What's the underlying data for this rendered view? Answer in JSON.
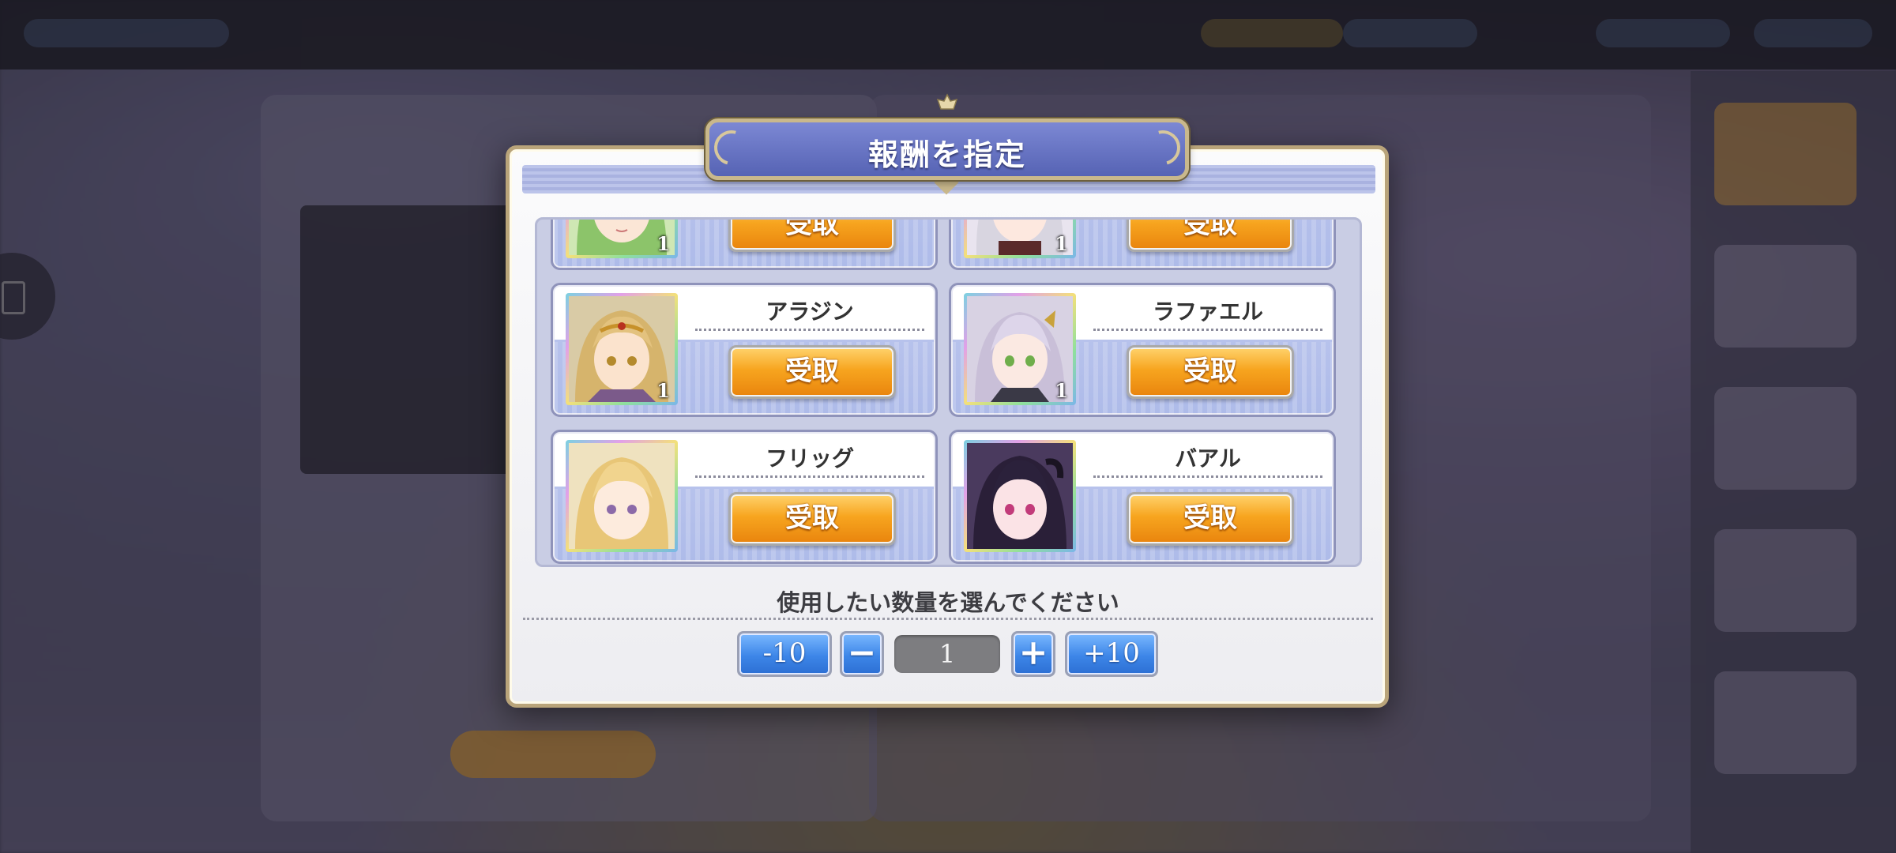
{
  "dialog": {
    "title": "報酬を指定",
    "quantity_prompt": "使用したい数量を選んでください"
  },
  "rewards": [
    {
      "name": "",
      "quantity": "1",
      "claim_label": "受取",
      "portrait": "green-haired-girl"
    },
    {
      "name": "",
      "quantity": "1",
      "claim_label": "受取",
      "portrait": "white-haired-girl"
    },
    {
      "name": "アラジン",
      "quantity": "1",
      "claim_label": "受取",
      "portrait": "blonde-tiara-girl"
    },
    {
      "name": "ラファエル",
      "quantity": "1",
      "claim_label": "受取",
      "portrait": "lavender-haired-girl"
    },
    {
      "name": "フリッグ",
      "quantity": "",
      "claim_label": "受取",
      "portrait": "golden-haired-girl"
    },
    {
      "name": "バアル",
      "quantity": "",
      "claim_label": "受取",
      "portrait": "black-haired-girl"
    }
  ],
  "stepper": {
    "minus10_label": "-10",
    "minus1_label": "−",
    "value": "1",
    "plus1_label": "+",
    "plus10_label": "+10"
  },
  "colors": {
    "claim_button": "#f7a51f",
    "stepper_button": "#3d86e8",
    "title_plate": "#5663b4",
    "frame_gold": "#b9a47a"
  }
}
